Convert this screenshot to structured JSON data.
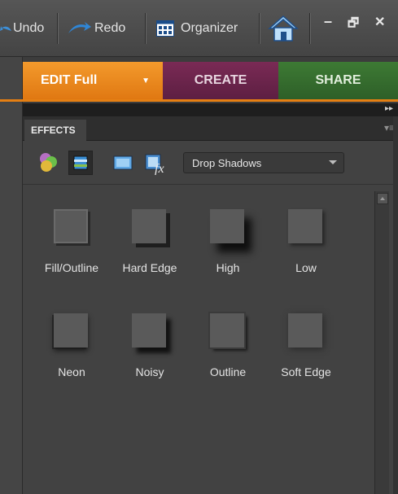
{
  "toolbar": {
    "undo_label": "Undo",
    "redo_label": "Redo",
    "organizer_label": "Organizer",
    "minimize_label": "–",
    "restore_label": "🗗",
    "close_label": "✕"
  },
  "tabs": {
    "edit_label": "EDIT Full",
    "edit_arrow": "▼",
    "create_label": "CREATE",
    "share_label": "SHARE"
  },
  "panel": {
    "tab_label": "EFFECTS",
    "menu_glyph": "▾≡",
    "collapse_glyph": "▸▸"
  },
  "filter": {
    "selected": "Drop Shadows"
  },
  "effects": [
    {
      "label": "Fill/Outline",
      "style": "fill"
    },
    {
      "label": "Hard Edge",
      "style": "hard"
    },
    {
      "label": "High",
      "style": "high"
    },
    {
      "label": "Low",
      "style": "low"
    },
    {
      "label": "Neon",
      "style": "neon"
    },
    {
      "label": "Noisy",
      "style": "noisy"
    },
    {
      "label": "Outline",
      "style": "outline"
    },
    {
      "label": "Soft Edge",
      "style": "soft"
    }
  ],
  "colors": {
    "edit_tab": "#e8861a",
    "create_tab": "#6a2449",
    "share_tab": "#356b2e",
    "accent_line": "#e57f13"
  }
}
